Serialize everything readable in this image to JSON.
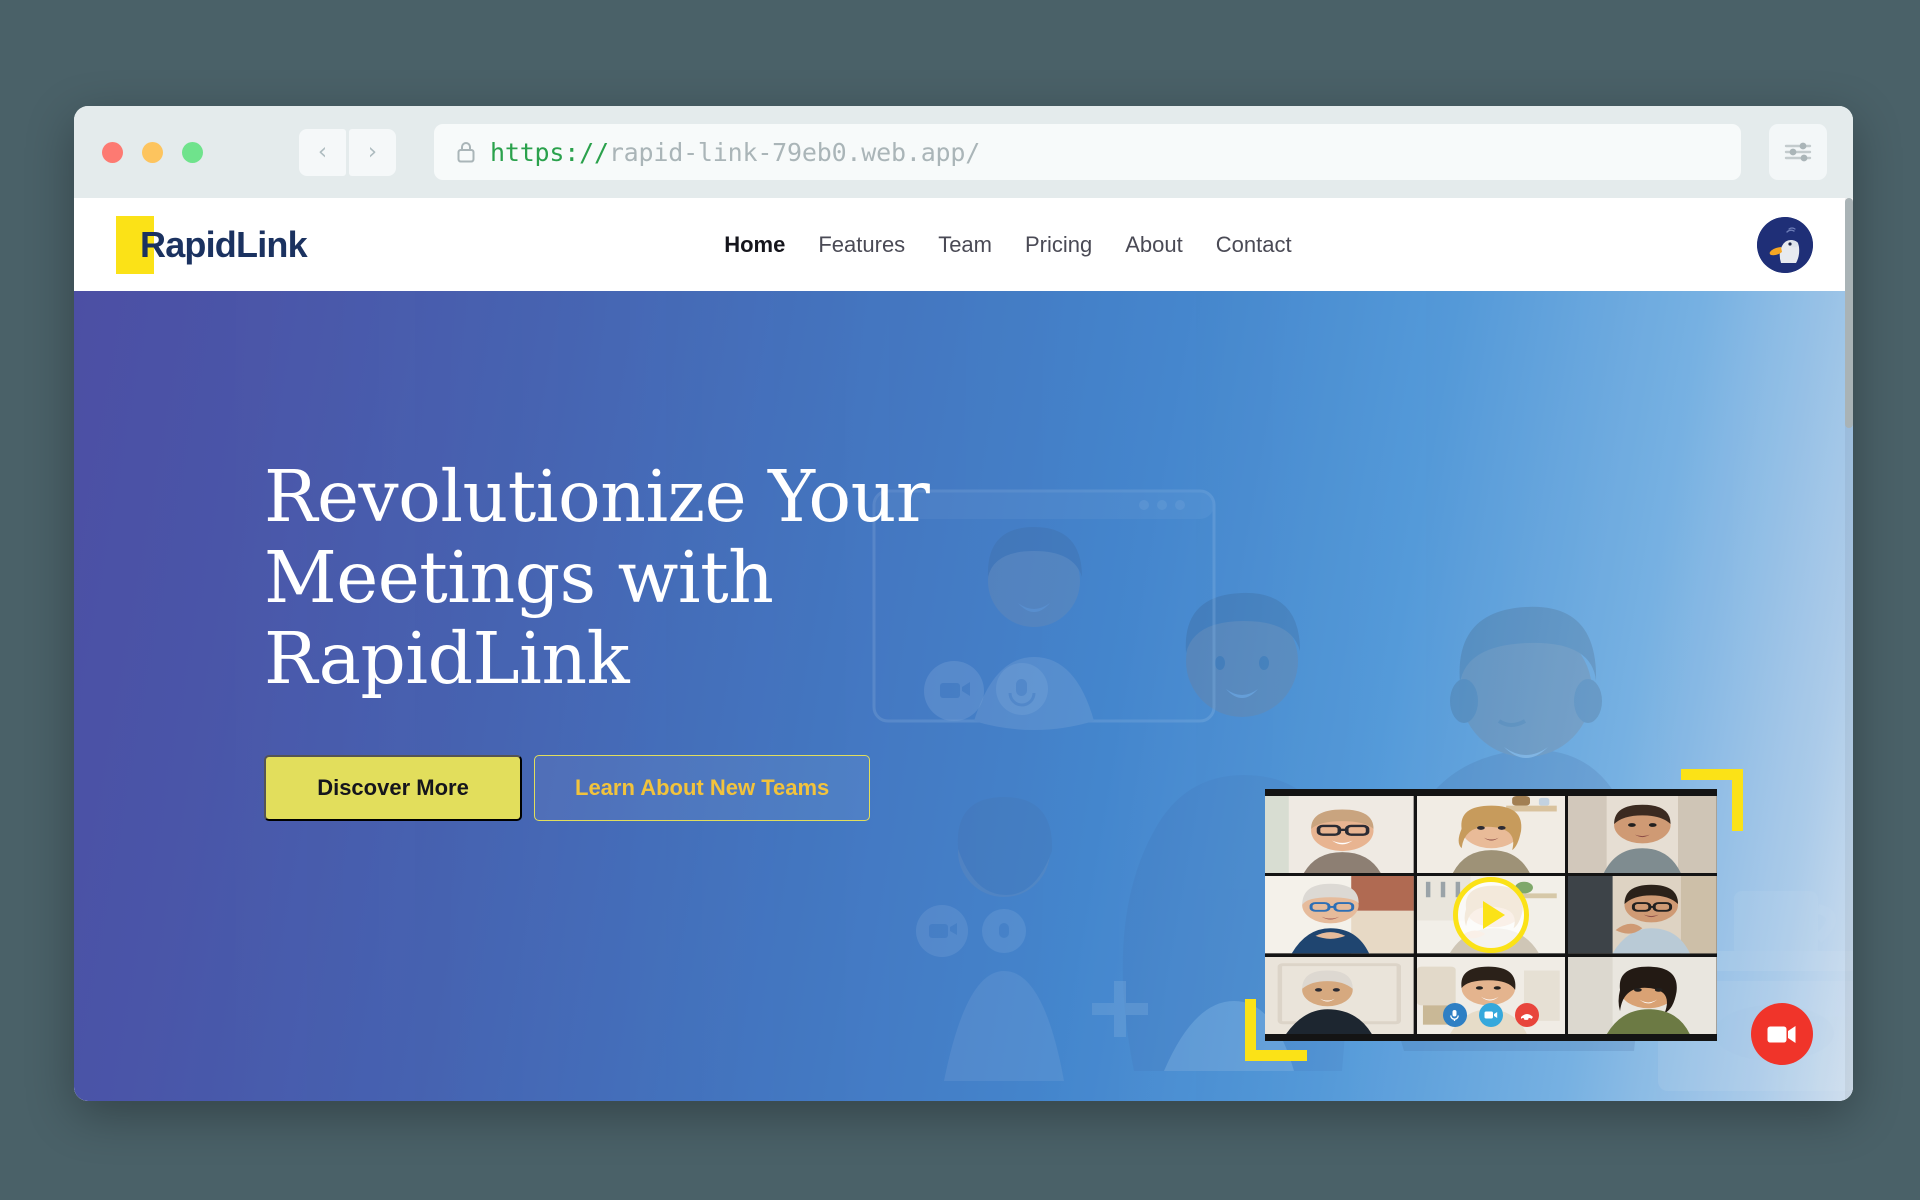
{
  "browser": {
    "traffic_lights": [
      "close",
      "minimize",
      "maximize"
    ],
    "back_glyph": "‹",
    "forward_glyph": "›",
    "url_scheme": "https://",
    "url_host": "rapid-link-79eb0.web.app/",
    "url_full": "https://rapid-link-79eb0.web.app/",
    "lock_icon": "lock-icon",
    "settings_icon": "sliders-icon"
  },
  "site": {
    "logo_text": "RapidLink",
    "logo_accent_color": "#fbe217",
    "logo_text_color": "#1b3260",
    "nav": [
      {
        "label": "Home",
        "active": true
      },
      {
        "label": "Features",
        "active": false
      },
      {
        "label": "Team",
        "active": false
      },
      {
        "label": "Pricing",
        "active": false
      },
      {
        "label": "About",
        "active": false
      },
      {
        "label": "Contact",
        "active": false
      }
    ],
    "avatar_alt": "duck-avatar"
  },
  "hero": {
    "title_line1": "Revolutionize Your",
    "title_line2": "Meetings with",
    "title_line3": "RapidLink",
    "primary_cta": "Discover More",
    "secondary_cta": "Learn About New Teams",
    "gradient_start": "#4c4fa4",
    "gradient_end": "#cfdeee",
    "accent_yellow": "#fbe217",
    "cta_primary_bg": "#e2de5c",
    "cta_secondary_text": "#f2c33c"
  },
  "video_panel": {
    "participants": 9,
    "play_button": "play-icon",
    "controls": [
      {
        "name": "microphone",
        "color": "#2e7fc4"
      },
      {
        "name": "camera",
        "color": "#35a8dc"
      },
      {
        "name": "end-call",
        "color": "#e8453c"
      }
    ]
  },
  "fab": {
    "icon": "video-camera-icon",
    "color": "#f0342a"
  }
}
